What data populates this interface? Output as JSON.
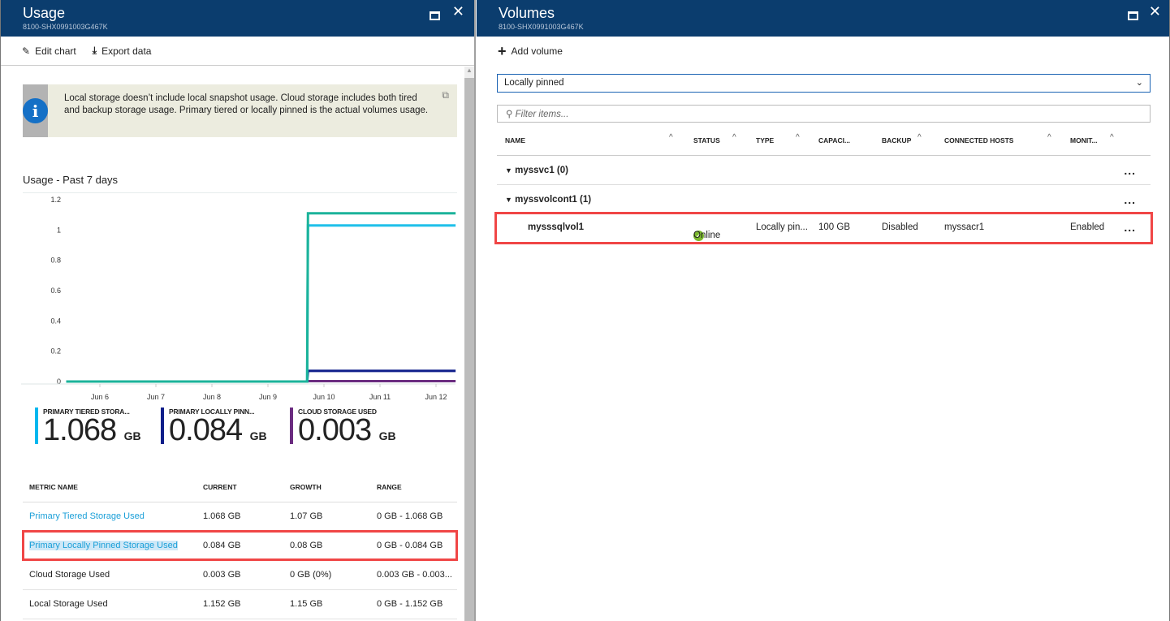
{
  "usage": {
    "title": "Usage",
    "subtitle": "8100-SHX0991003G467K",
    "toolbar": {
      "edit": "Edit chart",
      "export": "Export data"
    },
    "info": "Local storage doesn’t include local snapshot usage.  Cloud storage includes both tired and backup storage usage. Primary tiered or locally pinned is the actual volumes usage.",
    "chart_title": "Usage - Past 7 days",
    "tiles": [
      {
        "label": "PRIMARY TIERED STORA...",
        "value": "1.068",
        "unit": "GB",
        "color": "#00b7ee"
      },
      {
        "label": "PRIMARY LOCALLY PINN...",
        "value": "0.084",
        "unit": "GB",
        "color": "#0f1e8a"
      },
      {
        "label": "CLOUD STORAGE USED",
        "value": "0.003",
        "unit": "GB",
        "color": "#6b2c80"
      }
    ],
    "table": {
      "headers": [
        "METRIC NAME",
        "CURRENT",
        "GROWTH",
        "RANGE"
      ],
      "rows": [
        [
          "Primary Tiered Storage Used",
          "1.068 GB",
          "1.07 GB",
          "0 GB - 1.068 GB"
        ],
        [
          "Primary Locally Pinned Storage Used",
          "0.084 GB",
          "0.08 GB",
          "0 GB - 0.084 GB"
        ],
        [
          "Cloud Storage Used",
          "0.003 GB",
          "0 GB (0%)",
          "0.003 GB - 0.003..."
        ],
        [
          "Local Storage Used",
          "1.152 GB",
          "1.15 GB",
          "0 GB - 1.152 GB"
        ]
      ]
    }
  },
  "chart_data": {
    "type": "line",
    "title": "Usage - Past 7 days",
    "xlabel": "",
    "ylabel": "",
    "ylim": [
      0,
      1.2
    ],
    "yticks": [
      "0",
      "0.2",
      "0.4",
      "0.6",
      "0.8",
      "1",
      "1.2"
    ],
    "xticks": [
      "Jun 6",
      "Jun 7",
      "Jun 8",
      "Jun 9",
      "Jun 10",
      "Jun 11",
      "Jun 12"
    ],
    "x_range_days": [
      5.4,
      12.35
    ],
    "step_day": 9.7,
    "series": [
      {
        "name": "Local Storage Used",
        "color": "#1bb39a",
        "before": 0,
        "after": 1.11
      },
      {
        "name": "Primary Tiered Storage Used",
        "color": "#1ec0ea",
        "before": 0,
        "after": 1.03
      },
      {
        "name": "Primary Locally Pinned Storage Used",
        "color": "#0f1e8a",
        "before": 0,
        "after": 0.07
      },
      {
        "name": "Cloud Storage Used",
        "color": "#6b2c80",
        "before": 0,
        "after": 0.003
      }
    ]
  },
  "volumes": {
    "title": "Volumes",
    "subtitle": "8100-SHX0991003G467K",
    "add": "Add volume",
    "filter_value": "Locally pinned",
    "filter_placeholder": "Filter items...",
    "headers": [
      "NAME",
      "STATUS",
      "TYPE",
      "CAPACI...",
      "BACKUP",
      "CONNECTED HOSTS",
      "MONIT..."
    ],
    "groups": [
      {
        "name": "myssvc1 (0)"
      },
      {
        "name": "myssvolcont1 (1)"
      }
    ],
    "row": {
      "name": "mysssqlvol1",
      "status": "Online",
      "type": "Locally pin...",
      "capacity": "100 GB",
      "backup": "Disabled",
      "hosts": "myssacr1",
      "monitoring": "Enabled"
    },
    "more": "..."
  }
}
